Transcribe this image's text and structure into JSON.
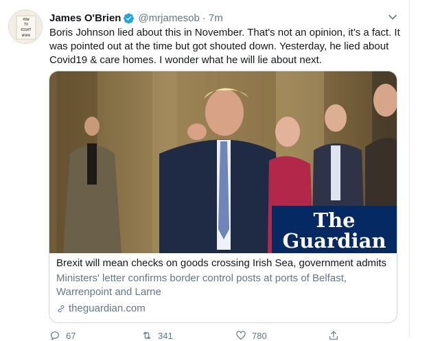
{
  "tweet": {
    "author_name": "James O'Brien",
    "handle": "@mrjamesob",
    "separator": "·",
    "time": "7m",
    "text": "Boris Johnson lied about this in November. That's not an opinion, it's a fact. It was pointed out at the time but got shouted down. Yesterday, he lied about Covid19 & care homes. I wonder what he will lie about next.",
    "avatar_text": [
      "HOW",
      "TO",
      "RIGHT",
      "WRONG"
    ]
  },
  "card": {
    "publisher_logo": [
      "The",
      "Guardian"
    ],
    "title": "Brexit will mean checks on goods crossing Irish Sea, government admits",
    "description": "Ministers' letter confirms border control posts at ports of Belfast, Warrenpoint and Larne",
    "domain": "theguardian.com"
  },
  "actions": {
    "reply_count": "67",
    "retweet_count": "341",
    "like_count": "780"
  },
  "colors": {
    "verified_blue": "#1da1f2",
    "guardian_navy": "#052962",
    "secondary_text": "#657786",
    "border": "#ccd6dd"
  },
  "icons": [
    "verified-badge-icon",
    "chevron-down-icon",
    "link-icon",
    "reply-icon",
    "retweet-icon",
    "like-icon",
    "share-icon"
  ]
}
